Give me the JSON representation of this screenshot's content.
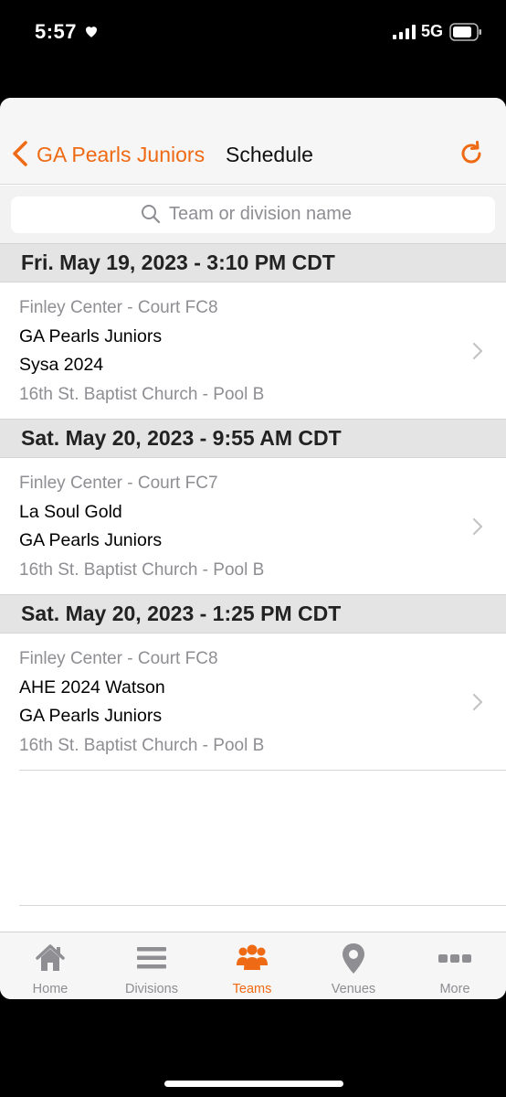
{
  "status": {
    "time": "5:57",
    "network": "5G"
  },
  "nav": {
    "back_label": "GA Pearls Juniors",
    "title": "Schedule"
  },
  "search": {
    "placeholder": "Team or division name"
  },
  "colors": {
    "accent": "#ee6a14",
    "secondary_text": "#8e8e93",
    "section_bg": "#e4e4e4"
  },
  "schedule": [
    {
      "date": "Fri. May 19, 2023 - 3:10 PM CDT",
      "venue": "Finley Center - Court FC8",
      "team1": "GA Pearls Juniors",
      "team2": "Sysa 2024",
      "pool": "16th St. Baptist Church - Pool B"
    },
    {
      "date": "Sat. May 20, 2023 - 9:55 AM CDT",
      "venue": "Finley Center - Court FC7",
      "team1": "La Soul Gold",
      "team2": "GA Pearls Juniors",
      "pool": "16th St. Baptist Church - Pool B"
    },
    {
      "date": "Sat. May 20, 2023 - 1:25 PM CDT",
      "venue": "Finley Center - Court FC8",
      "team1": "AHE 2024 Watson",
      "team2": "GA Pearls Juniors",
      "pool": "16th St. Baptist Church - Pool B"
    }
  ],
  "tabs": [
    {
      "label": "Home",
      "icon": "home-icon",
      "active": false
    },
    {
      "label": "Divisions",
      "icon": "list-icon",
      "active": false
    },
    {
      "label": "Teams",
      "icon": "people-icon",
      "active": true
    },
    {
      "label": "Venues",
      "icon": "location-pin-icon",
      "active": false
    },
    {
      "label": "More",
      "icon": "more-dots-icon",
      "active": false
    }
  ]
}
